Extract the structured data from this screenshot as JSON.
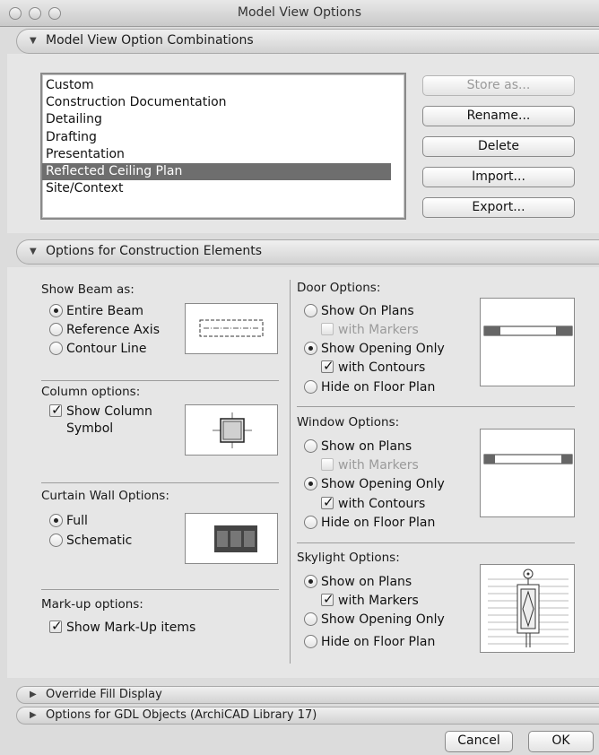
{
  "window": {
    "title": "Model View Options"
  },
  "sections": {
    "combinations": "Model View Option Combinations",
    "construction": "Options for Construction Elements",
    "override_fill": "Override Fill Display",
    "gdl": "Options for GDL Objects (ArchiCAD Library 17)"
  },
  "combinations_list": {
    "items": [
      "Custom",
      "Construction Documentation",
      "Detailing",
      "Drafting",
      "Presentation",
      "Reflected Ceiling Plan",
      "Site/Context"
    ],
    "selected": "Reflected Ceiling Plan"
  },
  "side_buttons": {
    "store_as": "Store as...",
    "rename": "Rename...",
    "delete": "Delete",
    "import": "Import...",
    "export": "Export..."
  },
  "beam": {
    "label": "Show Beam as:",
    "options": [
      "Entire Beam",
      "Reference Axis",
      "Contour Line"
    ],
    "selected": "Entire Beam"
  },
  "column": {
    "label": "Column options:",
    "show_symbol": "Show Column Symbol",
    "show_symbol_line1": "Show Column",
    "show_symbol_line2": "Symbol",
    "checked": true
  },
  "curtain_wall": {
    "label": "Curtain Wall Options:",
    "options": [
      "Full",
      "Schematic"
    ],
    "selected": "Full"
  },
  "markup": {
    "label": "Mark-up options:",
    "show_items": "Show Mark-Up items",
    "checked": true
  },
  "door": {
    "label": "Door Options:",
    "show_on_plans": "Show On Plans",
    "with_markers": "with Markers",
    "show_opening_only": "Show Opening Only",
    "with_contours": "with Contours",
    "hide": "Hide on Floor Plan",
    "selected": "Show Opening Only"
  },
  "window_opts": {
    "label": "Window Options:",
    "show_on_plans": "Show on Plans",
    "with_markers": "with Markers",
    "show_opening_only": "Show Opening Only",
    "with_contours": "with Contours",
    "hide": "Hide on Floor Plan",
    "selected": "Show Opening Only"
  },
  "skylight": {
    "label": "Skylight Options:",
    "show_on_plans": "Show on Plans",
    "with_markers": "with Markers",
    "show_opening_only": "Show Opening Only",
    "hide": "Hide on Floor Plan",
    "selected": "Show on Plans"
  },
  "footer": {
    "cancel": "Cancel",
    "ok": "OK"
  },
  "icons": {
    "collapse": "triangle-down-icon",
    "expand": "triangle-right-icon",
    "check": "checkmark-icon"
  },
  "colors": {
    "selection": "#6e6e6e",
    "background": "#e6e6e6"
  }
}
